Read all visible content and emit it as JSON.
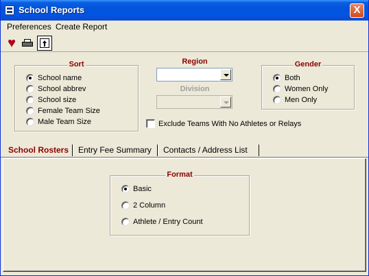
{
  "window": {
    "title": "School Reports",
    "close_label": "X"
  },
  "menu": {
    "items": [
      "Preferences",
      "Create Report"
    ]
  },
  "toolbar": {
    "icons": [
      "heart-icon",
      "printer-icon",
      "up-arrow-icon"
    ]
  },
  "sort": {
    "title": "Sort",
    "options": [
      "School name",
      "School abbrev",
      "School size",
      "Female Team Size",
      "Male Team Size"
    ],
    "selected": 0
  },
  "region": {
    "label": "Region",
    "value": ""
  },
  "division": {
    "label": "Division",
    "value": ""
  },
  "exclude": {
    "label": "Exclude Teams With No Athletes or Relays",
    "checked": false
  },
  "gender": {
    "title": "Gender",
    "options": [
      "Both",
      "Women Only",
      "Men Only"
    ],
    "selected": 0
  },
  "tabs": [
    {
      "label": "School Rosters",
      "active": true
    },
    {
      "label": "Entry Fee Summary",
      "active": false
    },
    {
      "label": "Contacts / Address List",
      "active": false
    }
  ],
  "format": {
    "title": "Format",
    "options": [
      "Basic",
      "2 Column",
      "Athlete / Entry Count"
    ],
    "selected": 0
  },
  "colors": {
    "accent_label": "#8b0000",
    "titlebar": "#0354d8",
    "window_bg": "#ece9d8"
  }
}
